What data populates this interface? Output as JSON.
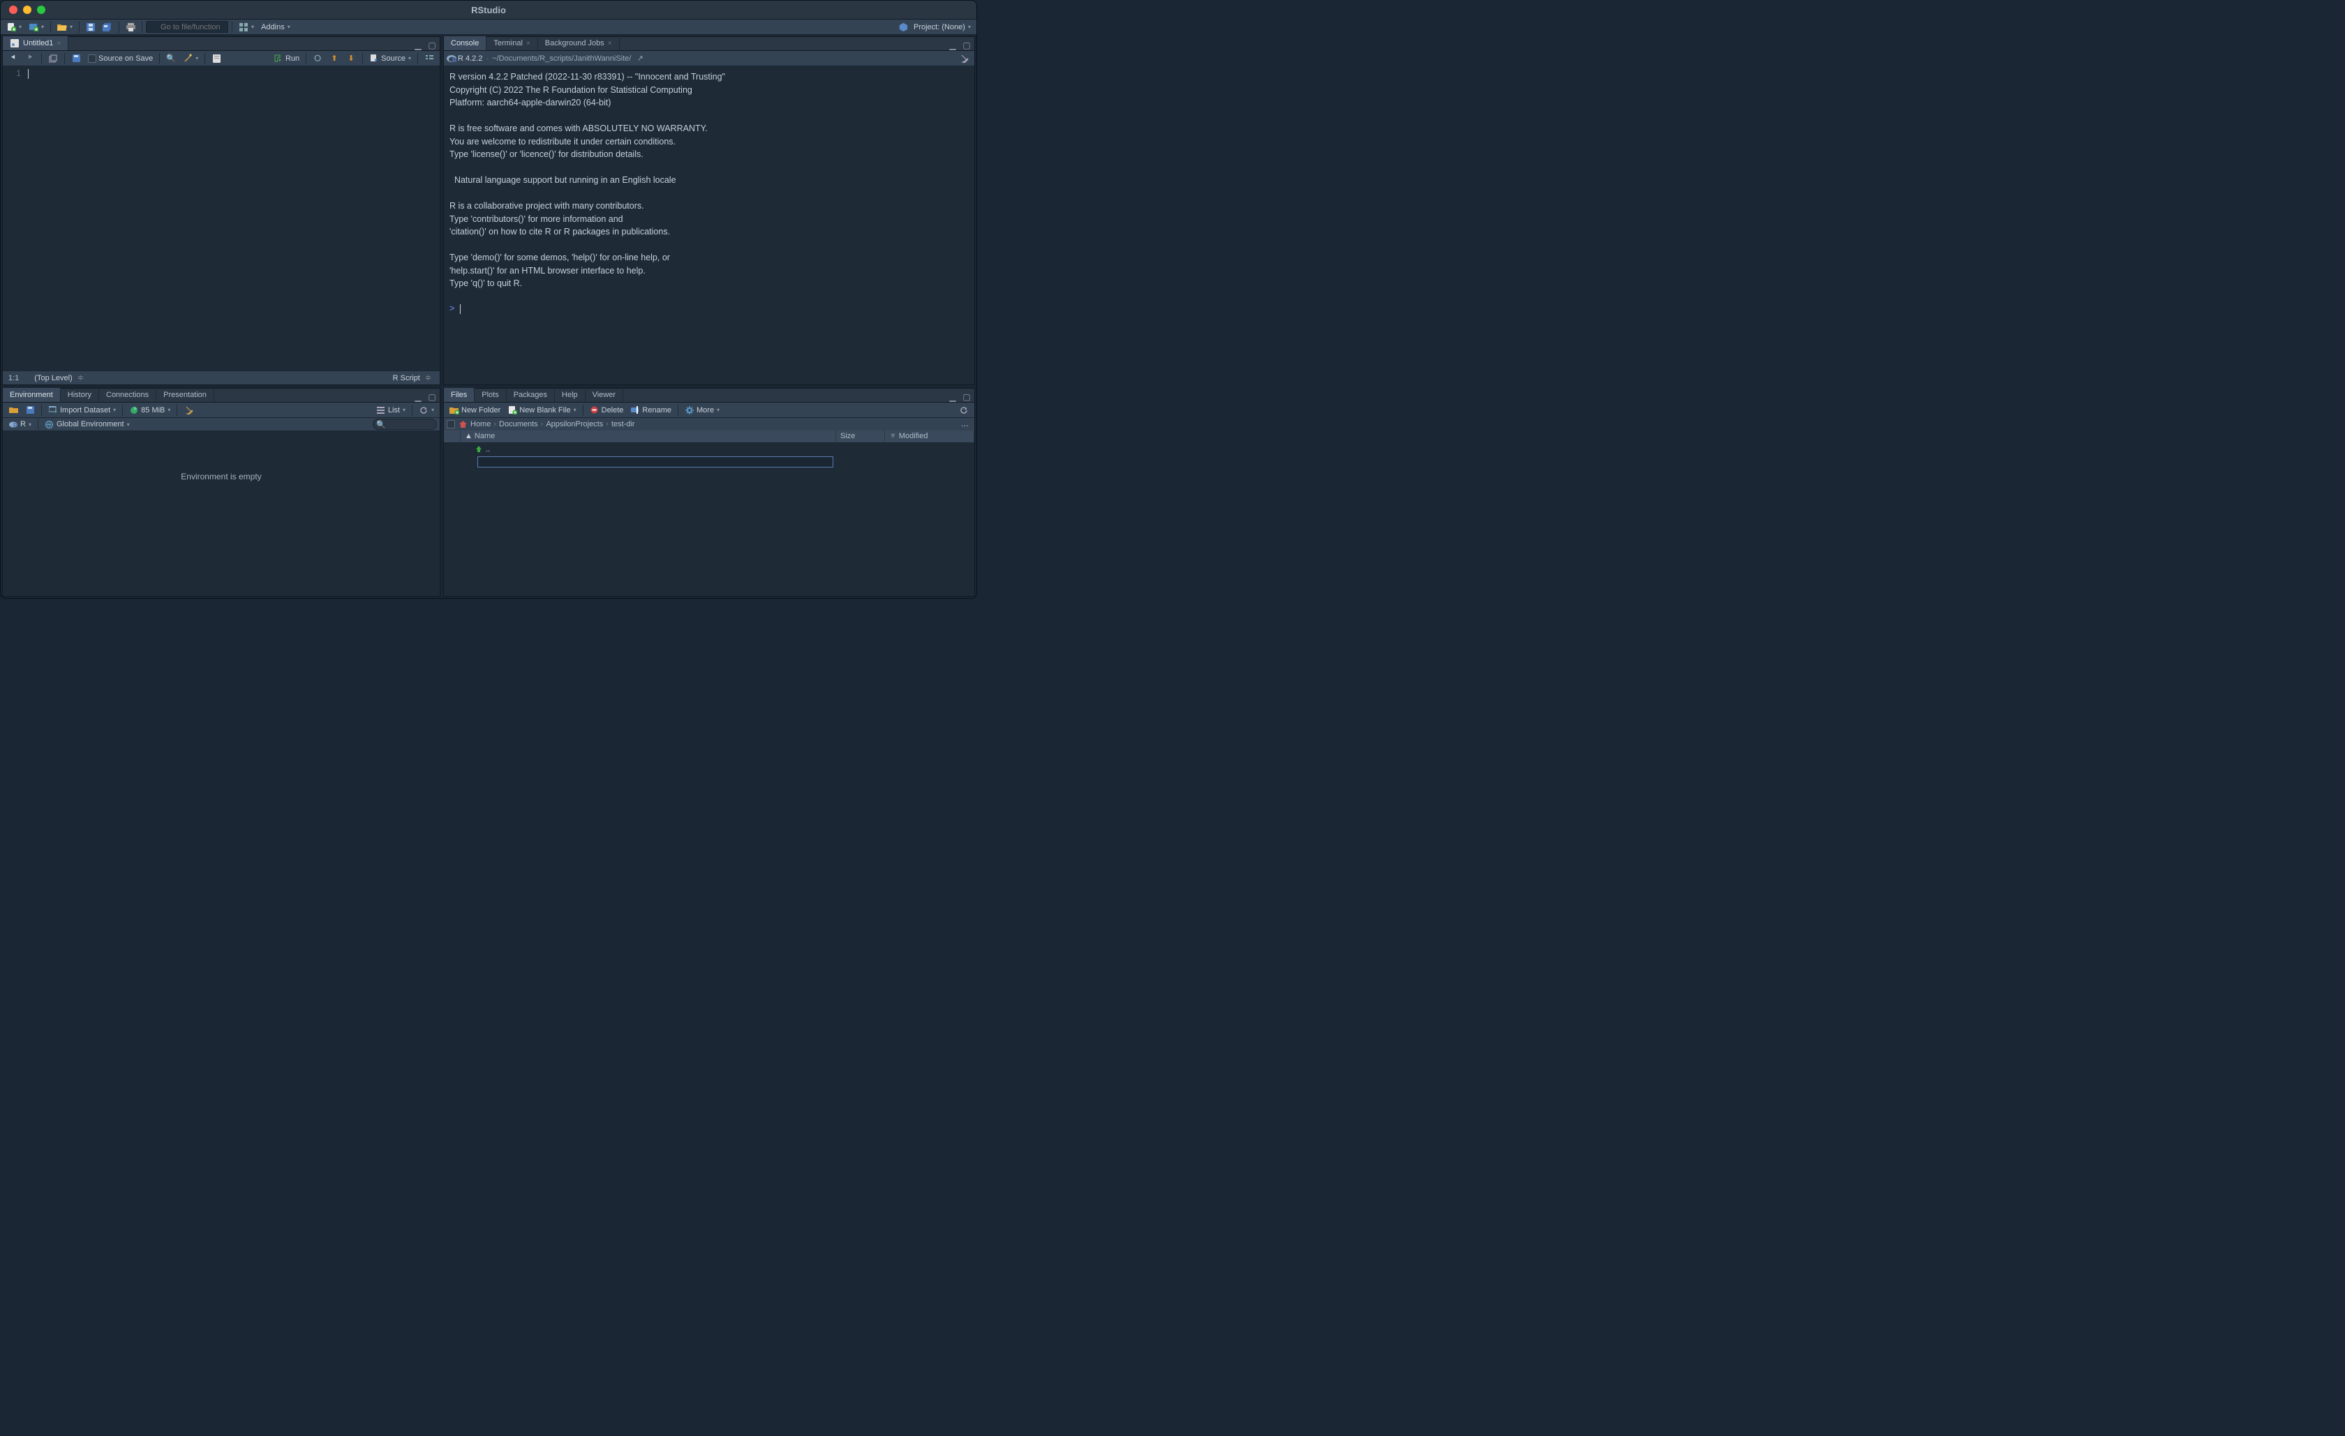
{
  "app": {
    "title": "RStudio"
  },
  "main_toolbar": {
    "goto_placeholder": "Go to file/function",
    "addins_label": "Addins",
    "project_label": "Project: (None)"
  },
  "editor": {
    "tab_title": "Untitled1",
    "source_on_save": "Source on Save",
    "run_label": "Run",
    "source_label": "Source",
    "line_number": "1",
    "status_pos": "1:1",
    "status_scope": "(Top Level)",
    "status_lang": "R Script"
  },
  "console": {
    "tabs": [
      "Console",
      "Terminal",
      "Background Jobs"
    ],
    "r_version": "R 4.2.2",
    "wd_path": "~/Documents/R_scripts/JanithWanniSite/",
    "text": "R version 4.2.2 Patched (2022-11-30 r83391) -- \"Innocent and Trusting\"\nCopyright (C) 2022 The R Foundation for Statistical Computing\nPlatform: aarch64-apple-darwin20 (64-bit)\n\nR is free software and comes with ABSOLUTELY NO WARRANTY.\nYou are welcome to redistribute it under certain conditions.\nType 'license()' or 'licence()' for distribution details.\n\n  Natural language support but running in an English locale\n\nR is a collaborative project with many contributors.\nType 'contributors()' for more information and\n'citation()' on how to cite R or R packages in publications.\n\nType 'demo()' for some demos, 'help()' for on-line help, or\n'help.start()' for an HTML browser interface to help.\nType 'q()' to quit R.\n",
    "prompt": ">"
  },
  "env": {
    "tabs": [
      "Environment",
      "History",
      "Connections",
      "Presentation"
    ],
    "import_label": "Import Dataset",
    "mem_label": "85 MiB",
    "view_label": "List",
    "r_menu": "R",
    "scope_label": "Global Environment",
    "empty_msg": "Environment is empty"
  },
  "files": {
    "tabs": [
      "Files",
      "Plots",
      "Packages",
      "Help",
      "Viewer"
    ],
    "new_folder": "New Folder",
    "new_blank": "New Blank File",
    "delete": "Delete",
    "rename": "Rename",
    "more": "More",
    "breadcrumbs": [
      "Home",
      "Documents",
      "AppsilonProjects",
      "test-dir"
    ],
    "col_name": "Name",
    "col_size": "Size",
    "col_modified": "Modified",
    "up_label": "..",
    "new_file_value": ""
  }
}
